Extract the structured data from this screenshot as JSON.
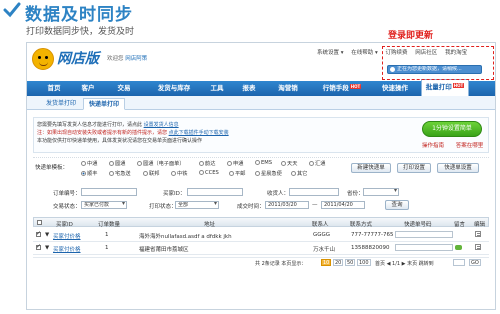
{
  "header": {
    "title": "数据及时同步",
    "subtitle": "打印数据同步快，发货及时"
  },
  "annotation": {
    "text": "登录即更新"
  },
  "app": {
    "logo_text": "网店版",
    "welcome_prefix": "欢迎您",
    "welcome_user": "网店阿策",
    "top_links": [
      "系统设置 ▾",
      "在线帮助 ▾",
      "订购续费",
      "网店社区",
      "我的淘宝"
    ],
    "notice": "正在为您更新数据，请稍候..."
  },
  "nav": {
    "items": [
      {
        "label": "首页"
      },
      {
        "label": "客户"
      },
      {
        "label": "交易"
      },
      {
        "label": "发货与库存"
      },
      {
        "label": "工具"
      },
      {
        "label": "报表"
      },
      {
        "label": "淘营销"
      },
      {
        "label": "行销手段"
      },
      {
        "label": "快速操作"
      },
      {
        "label": "批量打印"
      }
    ],
    "hot_badge": "HOT"
  },
  "subtabs": [
    {
      "label": "发货单打印"
    },
    {
      "label": "快递单打印"
    }
  ],
  "info": {
    "line1_prefix": "您需要先填写发货人信息才能进行打印，请点此",
    "line1_link": "设置发货人信息",
    "line2": "注：如果出现自动安装失败或者提示有新的插件提示，请您",
    "line2_link": "点此下载插件手动下载安装",
    "line3": "本功能仅供打印快递单使用，具体发货状况请您在交易单页面进行确认操作",
    "green_button": "1分钟设置简单",
    "help_links": [
      "操作指南",
      "答案在哪里"
    ]
  },
  "template": {
    "label": "快递单模板：",
    "options": [
      {
        "label": "中通",
        "on": false
      },
      {
        "label": "圆通",
        "on": false
      },
      {
        "label": "圆通（电子面单）",
        "on": false
      },
      {
        "label": "韵达",
        "on": false
      },
      {
        "label": "申通",
        "on": false
      },
      {
        "label": "EMS",
        "on": false
      },
      {
        "label": "天天",
        "on": false
      },
      {
        "label": "汇通",
        "on": false
      },
      {
        "label": "顺丰",
        "on": true
      },
      {
        "label": "宅急送",
        "on": false
      },
      {
        "label": "联邦",
        "on": false
      },
      {
        "label": "中铁",
        "on": false
      },
      {
        "label": "CCES",
        "on": false
      },
      {
        "label": "平邮",
        "on": false
      },
      {
        "label": "星晨急便",
        "on": false
      },
      {
        "label": "其它",
        "on": false
      }
    ],
    "buttons": [
      "新建快递单",
      "打印设置",
      "快递单设置"
    ]
  },
  "filters": {
    "order_no_label": "订单编号：",
    "buyer_id_label": "买家ID：",
    "receiver_label": "收货人：",
    "province_label": "省份：",
    "province_value": "",
    "status_label": "交易状态：",
    "status_value": "买家已付款",
    "print_status_label": "打印状态：",
    "print_status_value": "全部",
    "time_label": "成交时间：",
    "date_from": "2011/03/20",
    "date_to": "2011/04/20",
    "query_button": "查询"
  },
  "table": {
    "headers": [
      "买家ID",
      "订单数量",
      "地址",
      "联系人",
      "联系方式",
      "快递单号码",
      "留言",
      "编辑"
    ],
    "rows": [
      {
        "buyer": "买家付价格",
        "count": "1",
        "address": "海外海外nullafasd.asdf a dfdkk jkh",
        "contact": "GGGG",
        "phone": "777-77777-765"
      },
      {
        "buyer": "买家付价格",
        "count": "1",
        "address": "福建省莆田市荔城区",
        "contact": "万水千山",
        "phone": "13588820090"
      }
    ]
  },
  "pager": {
    "summary": "共 2条记录 本页显示：",
    "sizes": [
      "10",
      "20",
      "50",
      "100"
    ],
    "nav": "首页 ◀ 1/1 ▶ 末页 跳转到",
    "go": "GO"
  },
  "bottom": {
    "label": "全选"
  }
}
